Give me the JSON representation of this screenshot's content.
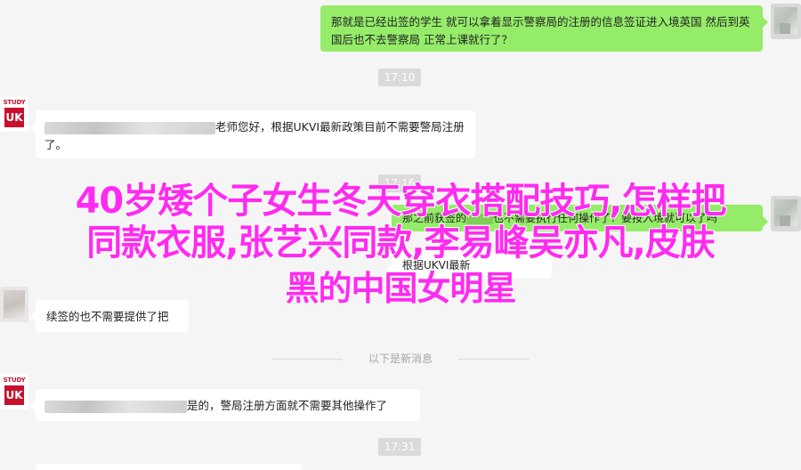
{
  "chat": {
    "msg1": {
      "text": "那就是已经出签的学生 就可以拿着显示警察局的注册的信息签证进入境英国 然后到英国后也不去警察局 正常上课就行了？"
    },
    "time1": "17:10",
    "msg2": {
      "avatar_brand": "STUDY",
      "avatar_mark": "UK",
      "text": "老师您好，根据UKVI最新政策目前不需要警局注册了。"
    },
    "time2": "17:16",
    "msg3": {
      "text_start": "那之前获签的",
      "text_end": "也不需要执行任何操作了？要按入境就可以了吗"
    },
    "msg4": {
      "text_start": "根据",
      "text_end": "UKVI最新"
    },
    "msg5": {
      "text": "续签的也不需要提供了把"
    },
    "separator": "以下是新消息",
    "msg6": {
      "avatar_brand": "STUDY",
      "avatar_mark": "UK",
      "text": "是的，警局注册方面就不需要其他操作了"
    },
    "time3": "17:31"
  },
  "overlay": {
    "line1": "40岁矮个子女生冬天穿衣搭配技巧,怎样把",
    "line2": "同款衣服,张艺兴同款,李易峰吴亦凡,皮肤",
    "line3": "黑的中国女明星",
    "color": "#ff2bf0"
  }
}
